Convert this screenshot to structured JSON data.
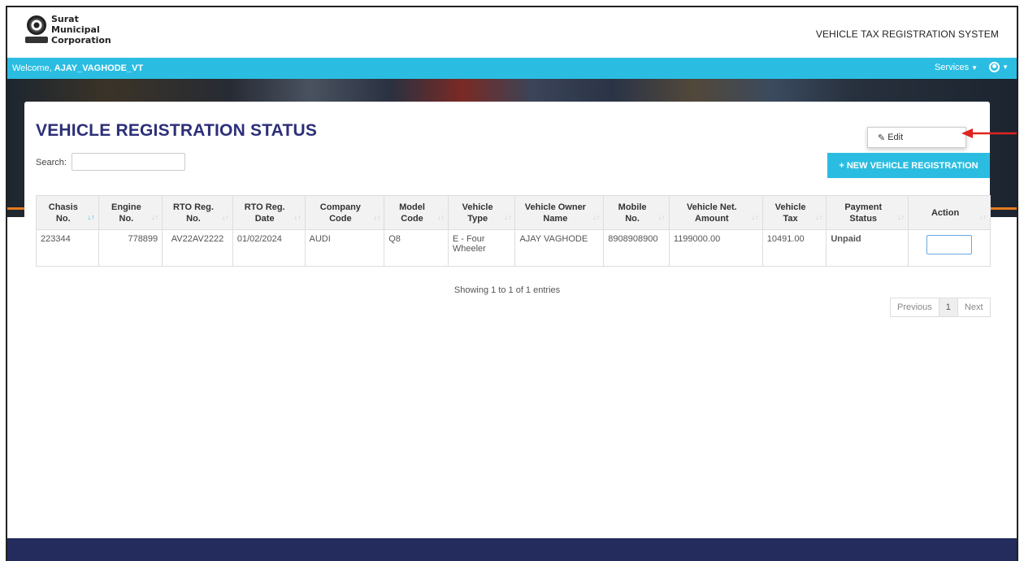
{
  "header": {
    "org_line1": "Surat",
    "org_line2": "Municipal",
    "org_line3": "Corporation",
    "system_title": "VEHICLE TAX REGISTRATION SYSTEM"
  },
  "navbar": {
    "welcome_prefix": "Welcome, ",
    "username": "AJAY_VAGHODE_VT",
    "services_label": "Services",
    "user_menu_icon": "user-circle-icon"
  },
  "page": {
    "title": "VEHICLE REGISTRATION STATUS",
    "search_label": "Search:",
    "search_value": "",
    "new_button_label": "NEW VEHICLE REGISTRATION"
  },
  "table": {
    "columns": [
      [
        "Chasis",
        "No."
      ],
      [
        "Engine",
        "No."
      ],
      [
        "RTO Reg.",
        "No."
      ],
      [
        "RTO Reg.",
        "Date"
      ],
      [
        "Company",
        "Code"
      ],
      [
        "Model",
        "Code"
      ],
      [
        "Vehicle",
        "Type"
      ],
      [
        "Vehicle Owner",
        "Name"
      ],
      [
        "Mobile",
        "No."
      ],
      [
        "Vehicle Net.",
        "Amount"
      ],
      [
        "Vehicle",
        "Tax"
      ],
      [
        "Payment",
        "Status"
      ],
      [
        "Action",
        ""
      ]
    ],
    "rows": [
      {
        "chasis_no": "223344",
        "engine_no": "778899",
        "rto_reg_no": "AV22AV2222",
        "rto_reg_date": "01/02/2024",
        "company_code": "AUDI",
        "model_code": "Q8",
        "vehicle_type_l1": "E - Four",
        "vehicle_type_l2": "Wheeler",
        "owner_name": "AJAY VAGHODE",
        "mobile_no": "8908908900",
        "net_amount": "1199000.00",
        "vehicle_tax": "10491.00",
        "payment_status": "Unpaid"
      }
    ]
  },
  "action_menu": {
    "edit_label": "Edit"
  },
  "pagination": {
    "info": "Showing 1 to 1 of 1 entries",
    "previous": "Previous",
    "current": "1",
    "next": "Next"
  },
  "colors": {
    "accent": "#2bbde1",
    "title": "#2c2f78",
    "unpaid": "#d9302c",
    "footer": "#232c5c",
    "arrow": "#e0241f"
  }
}
